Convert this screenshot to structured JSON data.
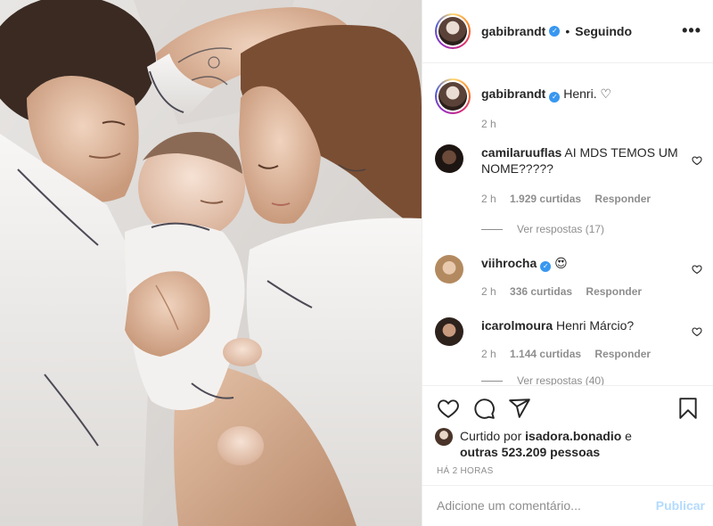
{
  "post": {
    "username": "gabibrandt",
    "follow_status": "Seguindo",
    "more_label": "•••",
    "verified_mark": "✓",
    "separator": "•"
  },
  "caption": {
    "username": "gabibrandt",
    "text": "Henri. ♡",
    "time": "2 h"
  },
  "comments": [
    {
      "username": "camilaruuflas",
      "text": "AI MDS TEMOS UM NOME?????",
      "time": "2 h",
      "likes": "1.929 curtidas",
      "reply": "Responder",
      "view_replies": "Ver respostas (17)"
    },
    {
      "username": "viihrocha",
      "verified": true,
      "text": "😍",
      "time": "2 h",
      "likes": "336 curtidas",
      "reply": "Responder"
    },
    {
      "username": "icarolmoura",
      "text": "Henri Márcio?",
      "time": "2 h",
      "likes": "1.144 curtidas",
      "reply": "Responder",
      "view_replies": "Ver respostas (40)"
    }
  ],
  "likes": {
    "prefix": "Curtido por",
    "user": "isadora.bonadio",
    "conj": "e",
    "others": "outras 523.209 pessoas"
  },
  "timestamp": "HÁ 2 HORAS",
  "add_comment": {
    "placeholder": "Adicione um comentário...",
    "publish": "Publicar"
  },
  "colors": {
    "link_blue": "#0095f6",
    "publish_disabled": "#b3dbff",
    "verified": "#3897f0",
    "muted": "#8e8e8e",
    "text": "#262626"
  },
  "icons": [
    "heart-icon",
    "comment-icon",
    "share-icon",
    "bookmark-icon",
    "more-options-icon",
    "verified-icon"
  ]
}
